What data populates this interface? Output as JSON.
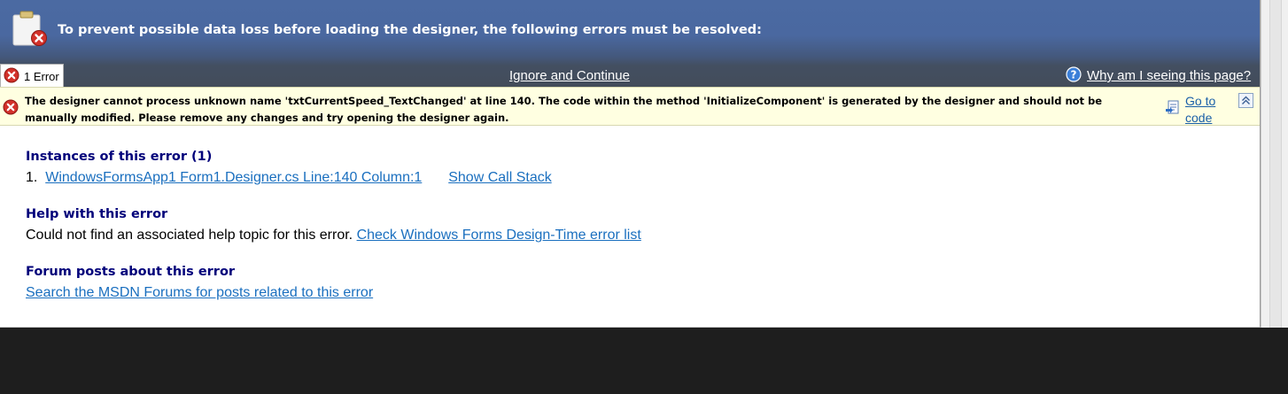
{
  "header": {
    "title": "To prevent possible data loss before loading the designer, the following errors must be resolved:",
    "clipboard_icon": "clipboard-error-icon"
  },
  "tab": {
    "label": "1 Error",
    "icon": "error-x-icon"
  },
  "actions": {
    "ignore_label": "Ignore and Continue",
    "why_label": "Why am I seeing this page?",
    "help_icon": "help-question-icon"
  },
  "error": {
    "message": "The designer cannot process unknown name 'txtCurrentSpeed_TextChanged' at line 140. The code within the method 'InitializeComponent' is generated by the designer and should not be manually modified. Please remove any changes and try opening the designer again.",
    "goto_label_1": "Go to",
    "goto_label_2": "code",
    "collapse_icon": "collapse-up-icon"
  },
  "instances": {
    "heading": "Instances of this error (1)",
    "items": [
      {
        "number": "1.",
        "location": "WindowsFormsApp1 Form1.Designer.cs Line:140 Column:1",
        "call_stack_label": "Show Call Stack"
      }
    ]
  },
  "help": {
    "heading": "Help with this error",
    "text": "Could not find an associated help topic for this error.",
    "link": "Check Windows Forms Design-Time error list"
  },
  "forum": {
    "heading": "Forum posts about this error",
    "link": "Search the MSDN Forums for posts related to this error"
  },
  "colors": {
    "header_blue": "#4b6aa2",
    "header_dark": "#434c5a",
    "error_bar_bg": "#ffffe1",
    "heading_navy": "#00007a",
    "link_blue": "#1a6fbf",
    "error_red": "#d2312a"
  }
}
